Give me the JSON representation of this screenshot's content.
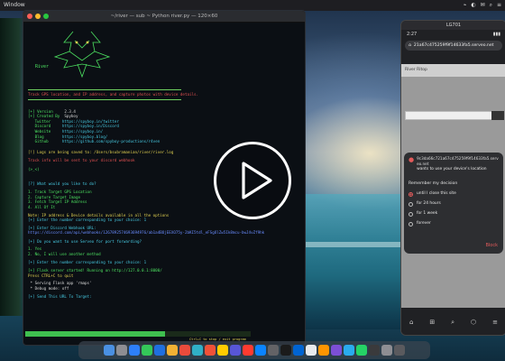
{
  "menubar": {
    "app_name": "Window",
    "right_items": [
      "⌁",
      "◐",
      "✉",
      "⌕",
      "≡"
    ]
  },
  "terminal": {
    "title": "~/river — sub ~ Python river.py — 120×60",
    "logo_text": "River",
    "tagline": "Track GPS location, and IP address, and capture photos with device details.",
    "info": [
      {
        "key": "[+] Version",
        "value": "2.3.4"
      },
      {
        "key": "[+] Created By",
        "value": "Spyboy"
      },
      {
        "key": "   Twitter",
        "value": "https://spyboy.in/twitter"
      },
      {
        "key": "   Discord",
        "value": "https://spyboy.in/Discord"
      },
      {
        "key": "   Website",
        "value": "https://spyboy.in/"
      },
      {
        "key": "   Blog",
        "value": "https://spyboy.blog/"
      },
      {
        "key": "   Github",
        "value": "https://github.com/spyboy-productions/r4ven"
      }
    ],
    "log_note": "[!] Logs are being saved to: /Users/bsubramanian/river/river.log",
    "track_note": "Track info will be sent to your discord webhook",
    "prompt_symbol": "(>_<)",
    "question1": "[?] What would you like to do?",
    "options": [
      "1. Track Target GPS Location",
      "2. Capture Target Image",
      "3. Fetch Target IP Address",
      "4. All Of It"
    ],
    "note": "Note: IP address & Device details available in all the options",
    "enter_option": "[+] Enter the number corresponding to your choice: 1",
    "enter_webhook": "[+] Enter Discord Webhook URL:",
    "webhook_url": "https://discord.com/api/webhooks/1267892574693694976/ab1a4BOjEEXO75y-2bKI5tdl_eFSgOlZw5Ik8mcu-bwJ4vZf9hk",
    "question2": "[+] Do you want to use Serveo for port forwarding?",
    "yes_no": [
      "1. Yes",
      "2. No, I will use another method"
    ],
    "enter_number": "[+] Enter the number corresponding to your choice: 1",
    "flask_started": "[+] Flask server started! Running on http://127.0.0.1:8000/",
    "press_ctrl": "Press CTRL+C to quit",
    "serving": " * Serving Flask app 'rmaps'",
    "debug": " * Debug mode: off",
    "send_url": "[+] Send This URL To Target:",
    "exit_hint": "Ctrl+C to stop / exit program",
    "progress_fraction": 0.62
  },
  "phone": {
    "window_title": "LG701",
    "time": "2:27",
    "url": "21a67c475259f9f14633fa5.serveo.net",
    "site_label": "River Ritop",
    "dialog": {
      "site": "9c3da66c721a67c475259f9f14633fa5.serveo.net",
      "request": "wants to use your device's location",
      "remember": "Remember my decision",
      "options": [
        "until I close this site",
        "for 24 hours",
        "for 1 week",
        "forever"
      ],
      "selected_index": 0,
      "block": "Block"
    },
    "nav_icons": [
      "⌂",
      "⊞",
      "⌕",
      "⬡",
      "≡"
    ]
  },
  "colors": {
    "accent_red": "#e25b5b",
    "terminal_green": "#4ce060",
    "terminal_cyan": "#46c8e0"
  }
}
